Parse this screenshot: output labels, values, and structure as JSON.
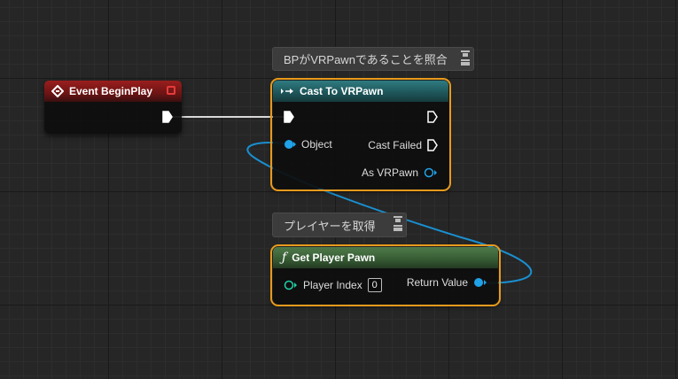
{
  "colors": {
    "exec": "#ffffff",
    "object_pin": "#1fa2e8",
    "selection": "#e89a1c",
    "event_header": "#8c1a1a",
    "cast_header": "#226066",
    "function_header": "#3f6a3c"
  },
  "comments": [
    {
      "text": "BPがVRPawnであることを照合"
    },
    {
      "text": "プレイヤーを取得"
    }
  ],
  "event_node": {
    "title": "Event BeginPlay",
    "icon": "event-diamond-icon"
  },
  "cast_node": {
    "title": "Cast To VRPawn",
    "icon": "cast-icon",
    "object_label": "Object",
    "cast_failed_label": "Cast Failed",
    "as_label": "As VRPawn"
  },
  "func_node": {
    "title": "Get Player Pawn",
    "icon": "function-f-icon",
    "player_index_label": "Player Index",
    "player_index_value": "0",
    "return_label": "Return Value"
  }
}
